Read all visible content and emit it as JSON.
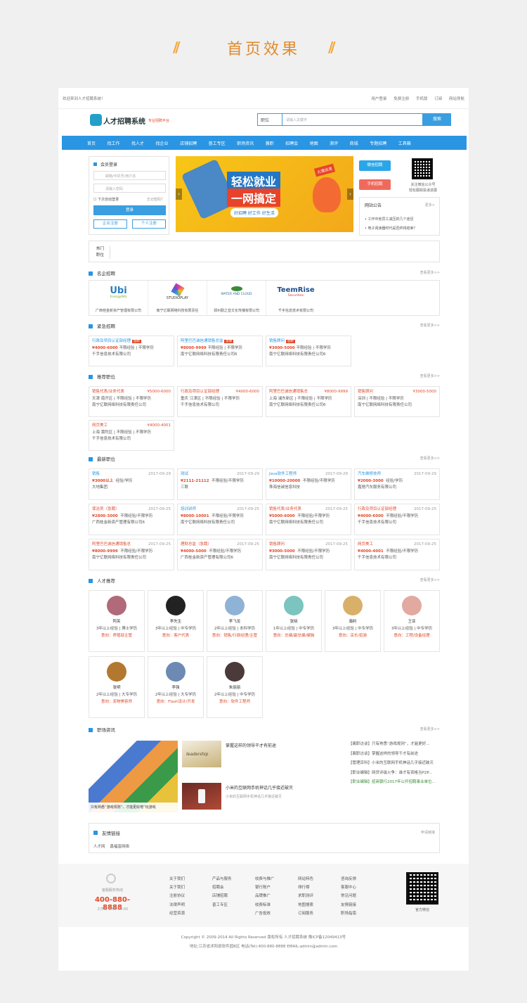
{
  "header": {
    "title": "首页效果"
  },
  "topbar": {
    "welcome": "欢迎来到人才招聘系统！",
    "links": [
      "用户登录",
      "免费注册",
      "手机版",
      "订阅",
      "网站导航"
    ]
  },
  "brand": {
    "name": "人才招聘系统",
    "slogan": "专业招聘平台"
  },
  "search": {
    "select": "职位",
    "placeholder": "请输入关键字",
    "button": "搜索"
  },
  "nav": [
    "首页",
    "找工作",
    "找人才",
    "找企业",
    "店铺招聘",
    "普工专区",
    "职场资讯",
    "兼职",
    "招聘会",
    "地图",
    "测评",
    "商城",
    "专题招聘",
    "工具箱"
  ],
  "login": {
    "title": "会员登录",
    "user_ph": "邮箱/手机号/用户名",
    "pwd_ph": "请输入密码",
    "remember": "下次自动登录",
    "forgot": "忘记密码？",
    "submit": "登录",
    "reg_company": "企业注册",
    "reg_person": "个人注册"
  },
  "banner": {
    "big1": "轻松就业",
    "big2": "一网搞定",
    "tags": "好招聘  好工作  好生活",
    "flag": "火速出发"
  },
  "side": {
    "wechat_btn": "微信招聘",
    "mobile_btn": "手机招聘",
    "qr_text1": "关注微信公众号",
    "qr_text2": "轻松跟踪投递进展",
    "notice_title": "网站公告",
    "notice_more": "更多>",
    "notices": [
      "工作中他员工减压的几个途径",
      "电子阅读器时代是否终将结束？"
    ]
  },
  "hot": {
    "label1": "热门",
    "label2": "职位"
  },
  "sections": {
    "famous": "名企招聘",
    "urgent": "紧急招聘",
    "recommend": "推荐职位",
    "latest": "最新职位",
    "talent": "人才推荐",
    "news": "职场资讯",
    "links": "友情链接",
    "more": "查看更多>>",
    "apply_link": "申请链接"
  },
  "famous": [
    {
      "logo": "Ubi",
      "sub": "EnergyWiz",
      "company": "广西桂金新资产管理有限公司"
    },
    {
      "logo": "STUDIOPLAY",
      "company": "南宁亿联网络科技有限责任"
    },
    {
      "logo": "WATER AND CLOUD",
      "company": "郑州勤之音文化传播有限公司"
    },
    {
      "logo": "TeemRise",
      "sub": "Securities",
      "company": "千手信息技术有限公司"
    }
  ],
  "urgent": [
    {
      "title": "行政及项目认证部经理",
      "tag": "急聘",
      "salary": "¥4000-6000",
      "req": "不限经验 | 不限学历",
      "company": "千手信息技术有限公司"
    },
    {
      "title": "阿里巴巴诚信通销售总监",
      "tag": "急聘",
      "salary": "¥8000-9999",
      "req": "不限经验 | 不限学历",
      "company": "南宁亿联网络科技有限责任公司6"
    },
    {
      "title": "销售顾问",
      "tag": "急聘",
      "salary": "¥3000-5000",
      "req": "不限经验 | 不限学历",
      "company": "南宁亿联网络科技有限责任公司6"
    }
  ],
  "recommend": [
    {
      "title": "销售代表/业务代表",
      "salary": "¥5000-6000",
      "loc": "天津 南开区 | 不限经验 | 不限学历",
      "company": "南宁亿联网络科技有限责任公司"
    },
    {
      "title": "行政及项目认证部经理",
      "salary": "¥4000-6000",
      "loc": "重庆 江津区 | 不限经验 | 不限学历",
      "company": "千手信息技术有限公司"
    },
    {
      "title": "阿里巴巴诚信通销售总",
      "salary": "¥8000-9999",
      "loc": "上海 浦东新区 | 不限经验 | 不限学历",
      "company": "南宁亿联网络科技有限责任公司6"
    },
    {
      "title": "销售顾问",
      "salary": "¥3000-5000",
      "loc": "深圳 | 不限经验 | 不限学历",
      "company": "南宁亿联网络科技有限责任公司"
    },
    {
      "title": "网页美工",
      "salary": "¥4000-4001",
      "loc": "上海 黄陀区 | 不限经验 | 不限学历",
      "company": "千手信息技术有限公司"
    }
  ],
  "latest": [
    {
      "title": "销售",
      "date": "2017-09-29",
      "salary": "¥3000以上",
      "req": "经验/学历",
      "company": "大地集团"
    },
    {
      "title": "测试",
      "date": "2017-09-29",
      "salary": "¥2111-21112",
      "req": "不限经验/不限学历",
      "company": "三联"
    },
    {
      "title": "Java软件工程师",
      "date": "2017-09-29",
      "salary": "¥10000-20000",
      "req": "不限经验/不限学历",
      "company": "珠海信诚信息科技"
    },
    {
      "title": "汽车维修技师",
      "date": "2017-09-29",
      "salary": "¥2000-3000",
      "req": "经验/学历",
      "company": "嘉驰汽车服务有限公司"
    },
    {
      "title": "保洁员（急聘）",
      "date": "2017-09-25",
      "salary": "¥2800-3000",
      "req": "不限经验/不限学历",
      "company": "广西桂金新资产管理有限公司6"
    },
    {
      "title": "培训讲师",
      "date": "2017-09-25",
      "salary": "¥8000-10001",
      "req": "不限经验/不限学历",
      "company": "南宁亿联网络科技有限责任公司"
    },
    {
      "title": "销售代表/业务代表",
      "date": "2017-09-25",
      "salary": "¥5000-6000",
      "req": "不限经验/不限学历",
      "company": "南宁亿联网络科技有限责任公司"
    },
    {
      "title": "行政及项目认证部经理",
      "date": "2017-09-25",
      "salary": "¥4000-6000",
      "req": "不限经验/不限学历",
      "company": "千手信息技术有限公司"
    },
    {
      "title": "阿里巴巴诚信通销售总",
      "date": "2017-09-25",
      "salary": "¥8000-9999",
      "req": "不限经验/不限学历",
      "company": "南宁亿联网络科技有限责任公司"
    },
    {
      "title": "理财总监（急聘）",
      "date": "2017-09-25",
      "salary": "¥4000-5000",
      "req": "不限经验/不限学历",
      "company": "广西桂金新资产管理有限公司6"
    },
    {
      "title": "销售顾问",
      "date": "2017-09-25",
      "salary": "¥3000-5000",
      "req": "不限经验/不限学历",
      "company": "南宁亿联网络科技有限责任公司"
    },
    {
      "title": "网页美工",
      "date": "2017-09-25",
      "salary": "¥4000-4001",
      "req": "不限经验/不限学历",
      "company": "千手信息技术有限公司"
    }
  ],
  "talents": [
    {
      "name": "阿芙",
      "info": "3年以上经验 | 博士学历",
      "intent": "意向：养殖部主管",
      "color": "#b06a7a"
    },
    {
      "name": "李先生",
      "info": "3年以上经验 | 中专学历",
      "intent": "意向：客户代表",
      "color": "#222"
    },
    {
      "name": "李飞龙",
      "info": "2年以上经验 | 本科学历",
      "intent": "意向：销售/行政经理/主管",
      "color": "#8fb3d6"
    },
    {
      "name": "张晓",
      "info": "1年以上经验 | 中专学历",
      "intent": "意向：总编/副总编/编辑",
      "color": "#7cc4c0"
    },
    {
      "name": "瀚利",
      "info": "3年以上经验 | 中专学历",
      "intent": "意向：店长/招游",
      "color": "#d9b06a"
    },
    {
      "name": "王亚",
      "info": "3年以上经验 | 中专学历",
      "intent": "意向：工程/设备经理",
      "color": "#e2a9a0"
    },
    {
      "name": "张明",
      "info": "2年以上经验 | 大专学历",
      "intent": "意向：宠物美容师",
      "color": "#b3782f"
    },
    {
      "name": "李强",
      "info": "2年以上经验 | 大专学历",
      "intent": "意向：Flash设计/开发",
      "color": "#6c8ab3"
    },
    {
      "name": "朱丽丽",
      "info": "2年以上经验 | 中专学历",
      "intent": "意向：软件工程师",
      "color": "#4a3a3a"
    }
  ],
  "news": {
    "caption": "只有熟悉“游戏规则”，才能更好地“玩游戏",
    "item1_title": "掌握这样的领导干才有前途",
    "item1_img": "leadership",
    "item2_title": "小米的互联网手机神话几乎接近破灭",
    "item2_desc": "小米的互联网手机神话几乎接近破灭",
    "list": [
      "【离职访谈】只有熟悉“游戏规则”，才能更好...",
      "【离职访谈】掌握这样的领导干才有前途",
      "【管理百科】小米的互联网手机神话几乎接近破灭",
      "【职业编辑】网贷评级火争：谁才有资格当P2P...",
      "【职业编辑】招商银行2017年公开招聘事业单位..."
    ]
  },
  "friend_links": [
    "人才网",
    "鑫福富网络"
  ],
  "footer": {
    "hotline_label": "客服服务热线",
    "phone": "400-880-8888",
    "hours": "工作日 9:00-19:00",
    "cols": [
      [
        "关于我们",
        "关于我们",
        "注册协议",
        "法律声明",
        "经营资源"
      ],
      [
        "产品与服务",
        "招聘会",
        "店铺招聘",
        "普工专区"
      ],
      [
        "收费与推广",
        "银行账户",
        "品牌推广",
        "收费标准",
        "广告投放"
      ],
      [
        "网站特色",
        "排行榜",
        "求职测评",
        "地图搜索",
        "订阅服务"
      ],
      [
        "咨询反馈",
        "客服中心",
        "常见问题",
        "友情链接",
        "职场指南"
      ]
    ],
    "qr_label": "官方微信",
    "copyright": "Copyright © 2009-2014 All Rights Reserved 版权所有 人才招聘系统 豫ICP备12049413号",
    "address": "地址:江苏省沭阳县软件园B区 电话(Tel):400-880-8888 EMAIL:admin@admin.com"
  },
  "colors": {
    "accent": "#2a95e2",
    "highlight": "#e04a2a",
    "title_orange": "#e08a2a"
  }
}
